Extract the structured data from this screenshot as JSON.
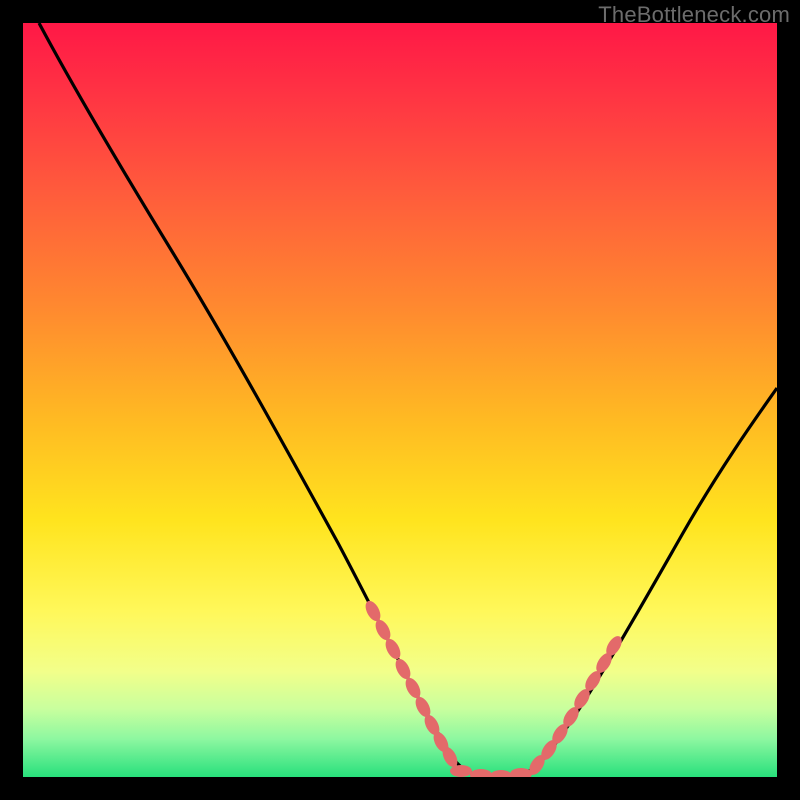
{
  "watermark": "TheBottleneck.com",
  "colors": {
    "curve": "#000000",
    "dots": "#e36a6a",
    "frame": "#000000"
  },
  "chart_data": {
    "type": "line",
    "title": "",
    "xlabel": "",
    "ylabel": "",
    "xlim": [
      0,
      100
    ],
    "ylim": [
      0,
      100
    ],
    "grid": false,
    "legend": false,
    "series": [
      {
        "name": "bottleneck-curve",
        "x": [
          0,
          6,
          12,
          18,
          24,
          30,
          36,
          42,
          47,
          51,
          55,
          58,
          61,
          64,
          70,
          76,
          82,
          88,
          94,
          100
        ],
        "y": [
          100,
          92,
          83,
          73,
          63,
          52,
          41,
          30,
          18,
          9,
          3,
          0,
          0,
          1,
          8,
          18,
          28,
          37,
          45,
          52
        ]
      },
      {
        "name": "dotted-segment-left",
        "x": [
          47,
          48,
          49,
          50,
          51,
          52,
          53,
          54,
          55
        ],
        "y": [
          18,
          15,
          12,
          10,
          8,
          6,
          4,
          2,
          1
        ]
      },
      {
        "name": "dotted-segment-bottom",
        "x": [
          56,
          58,
          60,
          62,
          64,
          66
        ],
        "y": [
          0,
          0,
          0,
          0,
          0,
          1
        ]
      },
      {
        "name": "dotted-segment-right",
        "x": [
          67,
          68.5,
          70,
          71.5,
          73,
          74.5,
          76
        ],
        "y": [
          2,
          5,
          8,
          11,
          14,
          17,
          19
        ]
      }
    ],
    "background_gradient_stops": [
      {
        "pos": 0.0,
        "color": "#ff1846"
      },
      {
        "pos": 0.22,
        "color": "#ff5a3c"
      },
      {
        "pos": 0.52,
        "color": "#ffb823"
      },
      {
        "pos": 0.78,
        "color": "#fff85a"
      },
      {
        "pos": 1.0,
        "color": "#28e07c"
      }
    ]
  }
}
